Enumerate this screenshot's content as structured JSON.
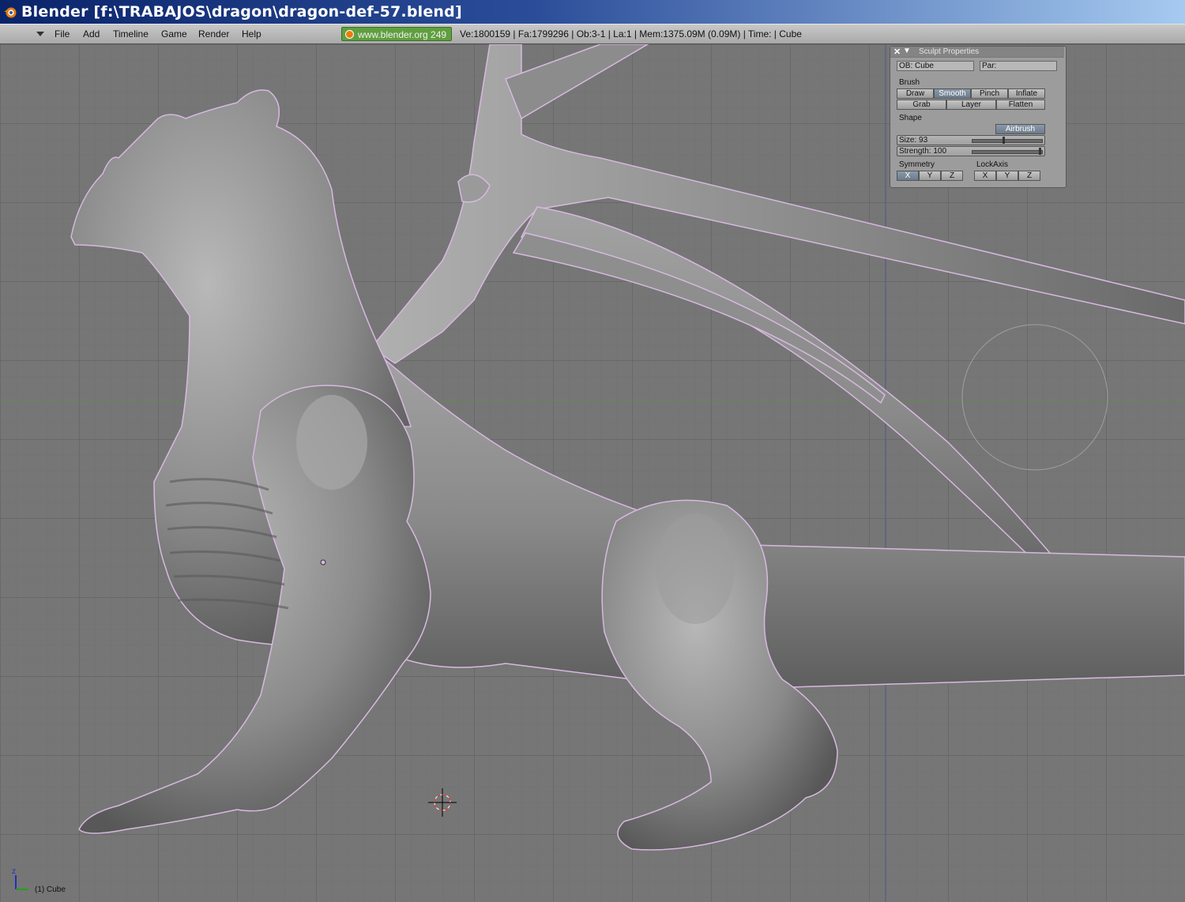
{
  "window": {
    "title": "Blender [f:\\TRABAJOS\\dragon\\dragon-def-57.blend]"
  },
  "menu": {
    "items": [
      "File",
      "Add",
      "Timeline",
      "Game",
      "Render",
      "Help"
    ],
    "site_label": "www.blender.org 249",
    "stats": "Ve:1800159 | Fa:1799296 | Ob:3-1 | La:1  | Mem:1375.09M (0.09M)  | Time: | Cube"
  },
  "sculpt_panel": {
    "title": "Sculpt Properties",
    "ob_field": "OB: Cube",
    "par_field": "Par:",
    "brush_label": "Brush",
    "brush_row1": [
      "Draw",
      "Smooth",
      "Pinch",
      "Inflate"
    ],
    "brush_row2": [
      "Grab",
      "Layer",
      "Flatten"
    ],
    "active_brush": "Smooth",
    "shape_label": "Shape",
    "airbrush_label": "Airbrush",
    "size_label": "Size: 93",
    "strength_label": "Strength: 100",
    "size_value": 93,
    "size_max": 200,
    "strength_value": 100,
    "strength_max": 100,
    "symmetry_label": "Symmetry",
    "symmetry_axes": [
      "X",
      "Y",
      "Z"
    ],
    "lockaxis_label": "LockAxis",
    "lockaxis_axes": [
      "X",
      "Y",
      "Z"
    ],
    "symmetry_active": "X"
  },
  "viewport": {
    "object_label": "(1) Cube",
    "axis_labels": {
      "z": "z"
    }
  },
  "colors": {
    "title_bar_start": "#0a246a",
    "title_bar_end": "#a6caf0",
    "menu_bg": "#b8b8b8",
    "site_button": "#5f9f3f",
    "viewport_bg": "#767676",
    "model_gray": "#8c8c8c",
    "selection_outline": "#e0b0e8",
    "panel_bg": "#a0a0a0",
    "active_button": "#7a8a9a"
  }
}
